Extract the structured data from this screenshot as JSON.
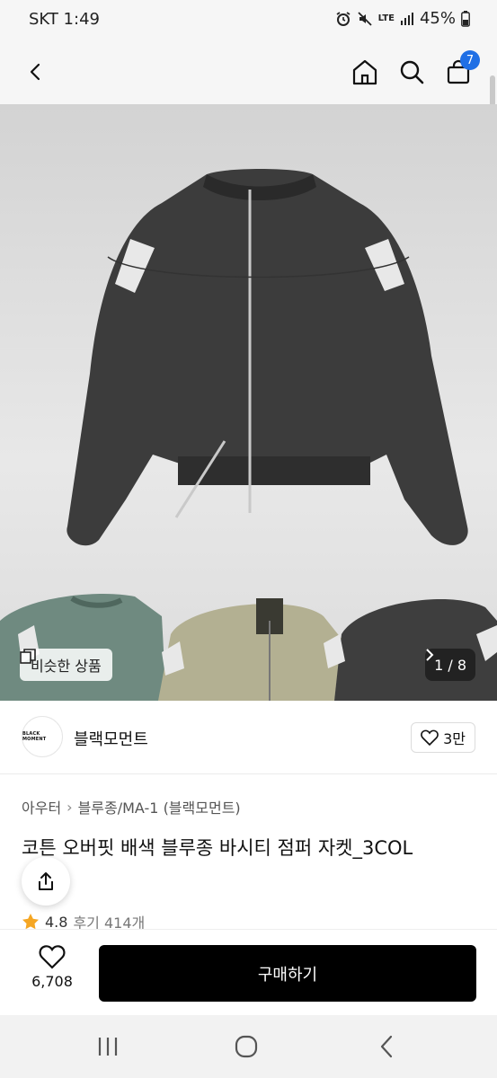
{
  "status_bar": {
    "carrier_time": "SKT 1:49",
    "network": "LTE",
    "battery": "45%"
  },
  "header": {
    "icons": [
      "back-arrow-icon",
      "home-icon",
      "search-icon",
      "cart-icon"
    ],
    "cart_count": "7"
  },
  "gallery": {
    "similar_label": "비슷한 상품",
    "page_indicator": "1 / 8",
    "colors": [
      "#3b3b3b",
      "#6f8a80",
      "#b3b092",
      "#3e3e3e"
    ]
  },
  "brand": {
    "logo_text": "BLACK MOMENT",
    "name": "블랙모먼트",
    "like_count": "3만"
  },
  "product": {
    "breadcrumb": [
      "아우터",
      "블루종/MA-1 (블랙모먼트)"
    ],
    "title": "코튼 오버핏 배색 블루종 바시티 점퍼 자켓_3COL",
    "rating": "4.8",
    "reviews": "후기 414개"
  },
  "purchase": {
    "wish_count": "6,708",
    "buy_label": "구매하기"
  },
  "nav": {
    "icons": [
      "recents-icon",
      "home-circle-icon",
      "back-chevron-icon"
    ]
  }
}
